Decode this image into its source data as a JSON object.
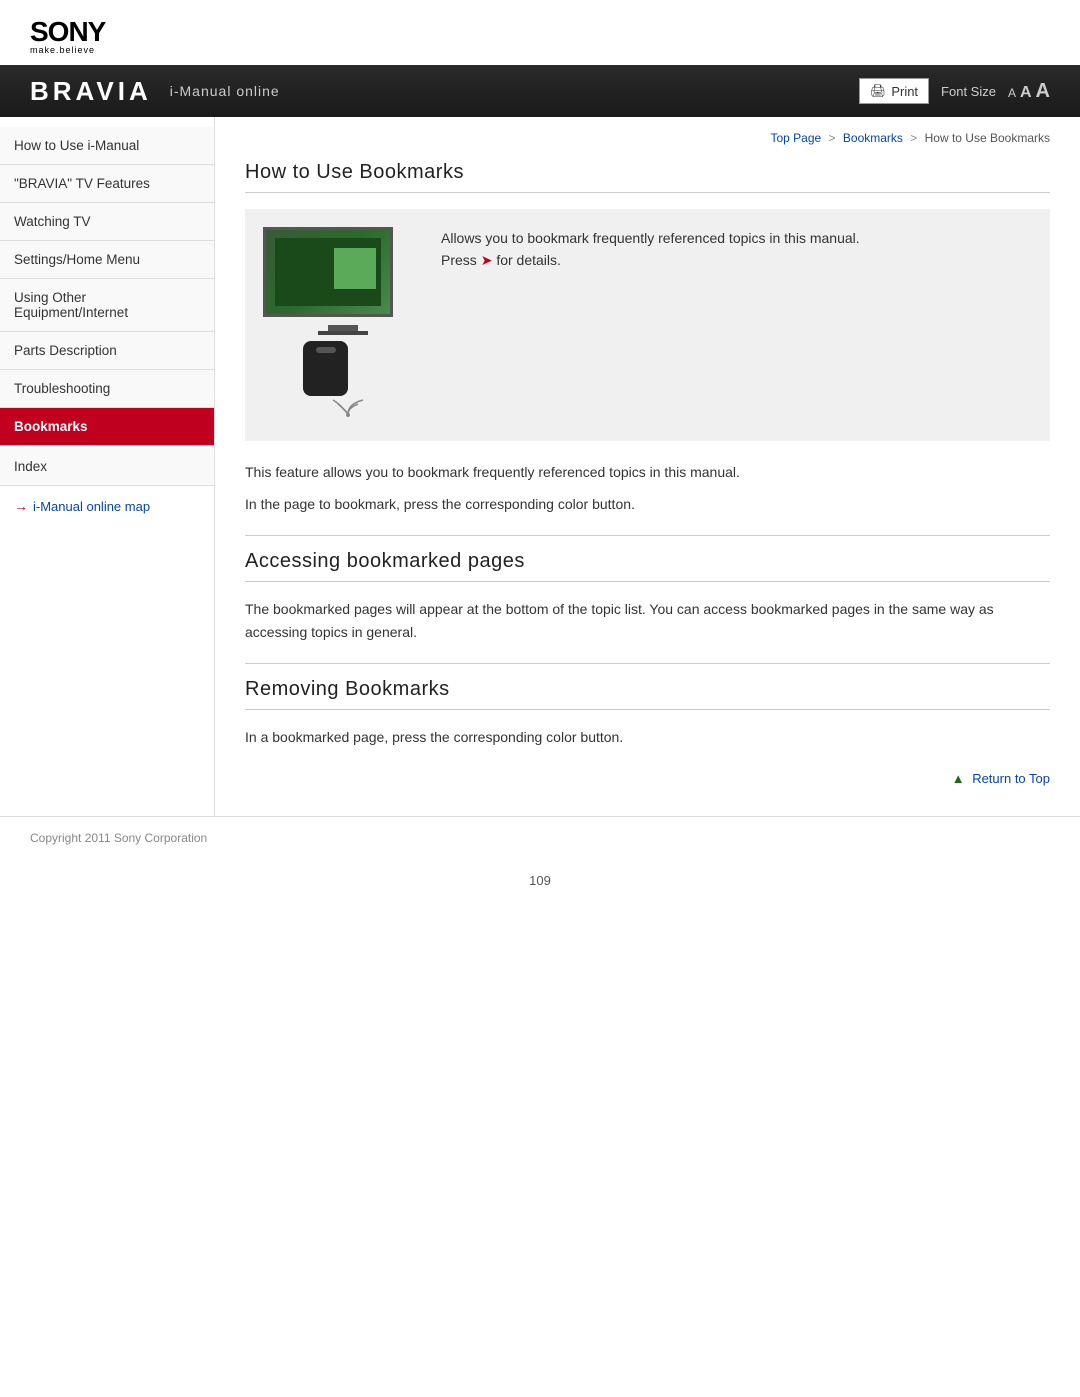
{
  "logo": {
    "sony": "SONY",
    "tagline": "make.believe"
  },
  "topbar": {
    "bravia": "BRAVIA",
    "subtitle": "i-Manual online",
    "print_label": "Print",
    "font_size_label": "Font Size",
    "font_small": "A",
    "font_medium": "A",
    "font_large": "A"
  },
  "breadcrumb": {
    "top_page": "Top Page",
    "bookmarks": "Bookmarks",
    "current": "How to Use Bookmarks",
    "sep1": ">",
    "sep2": ">"
  },
  "sidebar": {
    "items": [
      {
        "label": "How to Use i-Manual",
        "active": false
      },
      {
        "label": "\"BRAVIA\" TV Features",
        "active": false
      },
      {
        "label": "Watching TV",
        "active": false
      },
      {
        "label": "Settings/Home Menu",
        "active": false
      },
      {
        "label": "Using Other Equipment/Internet",
        "active": false
      },
      {
        "label": "Parts Description",
        "active": false
      },
      {
        "label": "Troubleshooting",
        "active": false
      },
      {
        "label": "Bookmarks",
        "active": true
      }
    ],
    "index_label": "Index",
    "map_link": "i-Manual online map"
  },
  "content": {
    "main_title": "How to Use Bookmarks",
    "feature_text_1": "Allows you to bookmark frequently referenced topics in this manual.",
    "feature_text_2": "Press",
    "feature_text_3": "for details.",
    "body_text_1": "This feature allows you to bookmark frequently referenced topics in this manual.",
    "body_text_2": "In the page to bookmark, press the corresponding color button.",
    "section2_title": "Accessing bookmarked pages",
    "section2_body": "The bookmarked pages will appear at the bottom of the topic list. You can access bookmarked pages in the same way as accessing topics in general.",
    "section3_title": "Removing Bookmarks",
    "section3_body": "In a bookmarked page, press the corresponding color button.",
    "return_to_top": "Return to Top"
  },
  "footer": {
    "copyright": "Copyright 2011 Sony Corporation"
  },
  "page_number": "109"
}
